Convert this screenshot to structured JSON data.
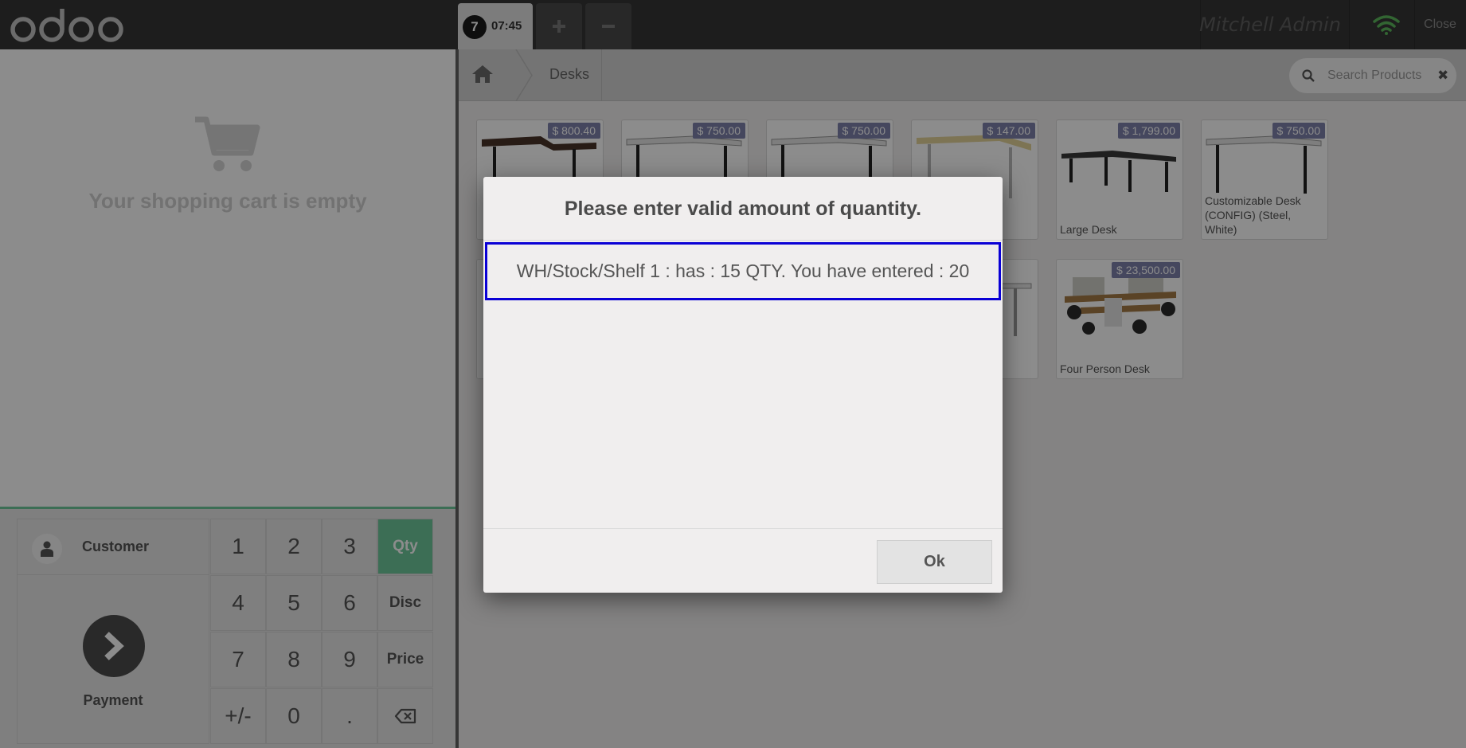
{
  "topbar": {
    "logo_text": "odoo",
    "order": {
      "number": "7",
      "time": "07:45"
    },
    "add_order_icon": "plus-icon",
    "remove_order_icon": "minus-icon",
    "username": "Mitchell Admin",
    "connection_icon": "wifi-icon",
    "connection_color": "#5cb85c",
    "close_label": "Close"
  },
  "cart": {
    "empty_message": "Your shopping cart is empty"
  },
  "controls": {
    "customer_label": "Customer",
    "payment_label": "Payment",
    "numpad_keys": [
      [
        "1",
        "2",
        "3",
        "Qty"
      ],
      [
        "4",
        "5",
        "6",
        "Disc"
      ],
      [
        "7",
        "8",
        "9",
        "Price"
      ],
      [
        "+/-",
        "0",
        ".",
        "⌫"
      ]
    ],
    "selected_mode": "Qty",
    "accent_color": "#6ec89b"
  },
  "breadcrumb": {
    "category": "Desks"
  },
  "search": {
    "placeholder": "Search Products",
    "clear_icon": "✖"
  },
  "products": [
    {
      "price": "$ 800.40",
      "name": ""
    },
    {
      "price": "$ 750.00",
      "name": ""
    },
    {
      "price": "$ 750.00",
      "name": ""
    },
    {
      "price": "$ 147.00",
      "name": ""
    },
    {
      "price": "$ 1,799.00",
      "name": "Large Desk"
    },
    {
      "price": "$ 750.00",
      "name": "Customizable Desk (CONFIG) (Steel, White)"
    },
    {
      "price": "",
      "name": ""
    },
    {
      "price": "",
      "name": ""
    },
    {
      "price": "",
      "name": ""
    },
    {
      "price": "",
      "name": ""
    },
    {
      "price": "$ 23,500.00",
      "name": "Four Person Desk"
    }
  ],
  "dialog": {
    "title": "Please enter valid amount of quantity.",
    "message": "WH/Stock/Shelf 1 : has : 15 QTY. You have entered : 20",
    "ok_label": "Ok",
    "highlight_color": "#0a00d5"
  }
}
